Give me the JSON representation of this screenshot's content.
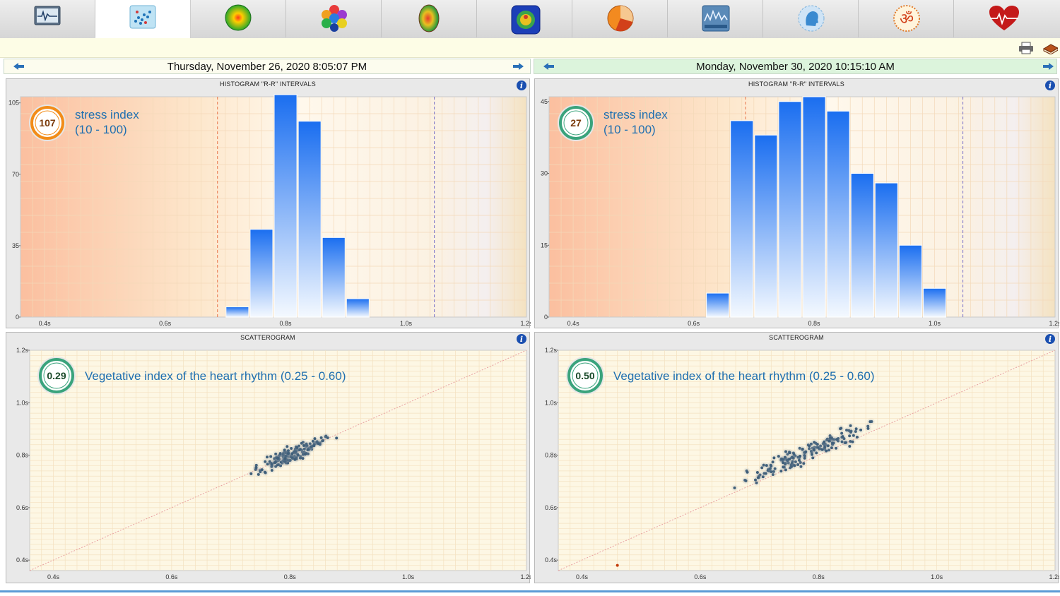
{
  "tabs": [
    {
      "icon": "ecg-monitor-icon"
    },
    {
      "icon": "scatter-dots-icon",
      "active": true
    },
    {
      "icon": "green-orb-icon"
    },
    {
      "icon": "hexagon-cluster-icon"
    },
    {
      "icon": "brain-heatmap-icon"
    },
    {
      "icon": "chakra-figure-icon"
    },
    {
      "icon": "pie-chart-icon"
    },
    {
      "icon": "spectrum-wave-icon"
    },
    {
      "icon": "head-profile-icon"
    },
    {
      "icon": "om-symbol-icon"
    },
    {
      "icon": "heart-pulse-icon"
    }
  ],
  "toolbar": {
    "print_icon": "printer-icon",
    "book_icon": "book-icon"
  },
  "left": {
    "date": "Thursday, November 26, 2020 8:05:07 PM",
    "histogram": {
      "title": "HISTOGRAM \"R-R\" INTERVALS",
      "badge_value": "107",
      "label_line1": "stress index",
      "label_line2": "(10 - 100)"
    },
    "scatter": {
      "title": "SCATTEROGRAM",
      "badge_value": "0.29",
      "label": "Vegetative index of the heart rhythm (0.25 - 0.60)"
    }
  },
  "right": {
    "date": "Monday, November 30, 2020 10:15:10 AM",
    "histogram": {
      "title": "HISTOGRAM \"R-R\" INTERVALS",
      "badge_value": "27",
      "label_line1": "stress index",
      "label_line2": "(10 - 100)"
    },
    "scatter": {
      "title": "SCATTEROGRAM",
      "badge_value": "0.50",
      "label": "Vegetative index of the heart rhythm (0.25 - 0.60)"
    }
  },
  "chart_data": [
    {
      "type": "bar",
      "title": "HISTOGRAM \"R-R\" INTERVALS",
      "x_ticks": [
        "0.4s",
        "0.6s",
        "0.8s",
        "1.0s",
        "1.2s"
      ],
      "y_ticks": [
        "0",
        "35",
        "70",
        "105"
      ],
      "xlim": [
        0.36,
        1.2
      ],
      "ylim": [
        0,
        108
      ],
      "bin_width": 0.04,
      "bins": [
        {
          "x": 0.7,
          "y": 5
        },
        {
          "x": 0.74,
          "y": 43
        },
        {
          "x": 0.78,
          "y": 109
        },
        {
          "x": 0.82,
          "y": 96
        },
        {
          "x": 0.86,
          "y": 39
        },
        {
          "x": 0.9,
          "y": 9
        }
      ],
      "markers": [
        0.687,
        1.047
      ],
      "colors": {
        "bar_top": "#1a6ef0",
        "bar_bottom": "#f4f9ff",
        "stress_ring": "#f28c18"
      }
    },
    {
      "type": "bar",
      "title": "HISTOGRAM \"R-R\" INTERVALS",
      "x_ticks": [
        "0.4s",
        "0.6s",
        "0.8s",
        "1.0s",
        "1.2s"
      ],
      "y_ticks": [
        "0",
        "15",
        "30",
        "45"
      ],
      "xlim": [
        0.36,
        1.2
      ],
      "ylim": [
        0,
        46
      ],
      "bin_width": 0.04,
      "bins": [
        {
          "x": 0.62,
          "y": 5
        },
        {
          "x": 0.66,
          "y": 41
        },
        {
          "x": 0.7,
          "y": 38
        },
        {
          "x": 0.74,
          "y": 45
        },
        {
          "x": 0.78,
          "y": 46
        },
        {
          "x": 0.82,
          "y": 43
        },
        {
          "x": 0.86,
          "y": 30
        },
        {
          "x": 0.9,
          "y": 28
        },
        {
          "x": 0.94,
          "y": 15
        },
        {
          "x": 0.98,
          "y": 6
        }
      ],
      "markers": [
        0.686,
        1.047
      ],
      "colors": {
        "bar_top": "#1a6ef0",
        "bar_bottom": "#f4f9ff",
        "stress_ring": "#3aa37c"
      }
    },
    {
      "type": "scatter",
      "title": "SCATTEROGRAM",
      "x_ticks": [
        "0.4s",
        "0.6s",
        "0.8s",
        "1.0s",
        "1.2s"
      ],
      "y_ticks": [
        "0.4s",
        "0.6s",
        "0.8s",
        "1.0s",
        "1.2s"
      ],
      "xlim": [
        0.36,
        1.2
      ],
      "ylim": [
        0.36,
        1.2
      ],
      "cluster": {
        "center": [
          0.8,
          0.8
        ],
        "x_spread": 0.055,
        "y_spread": 0.028,
        "count": 170,
        "x_range": [
          0.67,
          0.92
        ]
      },
      "colors": {
        "point": "#3f5f7a",
        "diagonal": "#e8a0a0",
        "ring": "#3aa37c"
      }
    },
    {
      "type": "scatter",
      "title": "SCATTEROGRAM",
      "x_ticks": [
        "0.4s",
        "0.6s",
        "0.8s",
        "1.0s",
        "1.2s"
      ],
      "y_ticks": [
        "0.4s",
        "0.6s",
        "0.8s",
        "1.0s",
        "1.2s"
      ],
      "xlim": [
        0.36,
        1.2
      ],
      "ylim": [
        0.36,
        1.2
      ],
      "cluster": {
        "center": [
          0.78,
          0.81
        ],
        "x_spread": 0.1,
        "y_spread": 0.035,
        "count": 170,
        "x_range": [
          0.61,
          0.98
        ]
      },
      "outlier": [
        0.46,
        0.38
      ],
      "colors": {
        "point": "#3f5f7a",
        "diagonal": "#e8a0a0",
        "ring": "#3aa37c",
        "outlier": "#c23a0a"
      }
    }
  ]
}
